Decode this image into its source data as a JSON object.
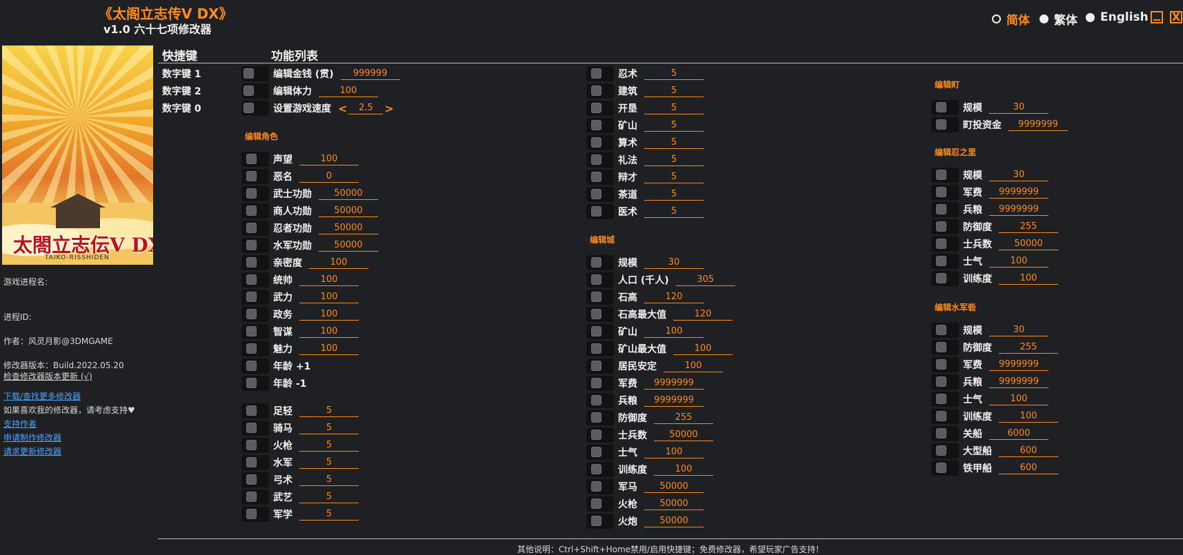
{
  "app": {
    "title": "《太阁立志传V DX》",
    "subtitle": "v1.0 六十七项修改器"
  },
  "languages": [
    {
      "label": "简体",
      "selected": true
    },
    {
      "label": "繁体",
      "selected": false
    },
    {
      "label": "English",
      "selected": false
    }
  ],
  "window_controls": {
    "minimize": "_",
    "close": "X"
  },
  "cover": {
    "logo_text": "太閤立志伝V DX",
    "logo_sub": "TAIKO-RISSHIDEN"
  },
  "sidebar": {
    "process_name_label": "游戏进程名:",
    "process_id_label": "进程ID:",
    "author": "作者：风灵月影@3DMGAME",
    "version": "修改器版本：Build.2022.05.20",
    "check_update": "检查修改器版本更新 (√)",
    "download_link": "下载/查找更多修改器",
    "support_text": "如果喜欢我的修改器，请考虑支持♥",
    "support_link": "支持作者",
    "request_link": "申请制作修改器",
    "update_link": "请求更新修改器"
  },
  "headers": {
    "hotkey": "快捷键",
    "features": "功能列表"
  },
  "hotkeys": [
    "数字键 1",
    "数字键 2",
    "数字键 0"
  ],
  "top_options": [
    {
      "label": "编辑金钱 (贯)",
      "value": "999999"
    },
    {
      "label": "编辑体力",
      "value": "100"
    }
  ],
  "speed": {
    "label": "设置游戏速度",
    "left": "<",
    "value": "2.5",
    "right": ">"
  },
  "col1": {
    "section_title": "编辑角色",
    "group1": [
      {
        "label": "声望",
        "value": "100"
      },
      {
        "label": "恶名",
        "value": "0"
      },
      {
        "label": "武士功勋",
        "value": "50000"
      },
      {
        "label": "商人功勋",
        "value": "50000"
      },
      {
        "label": "忍者功勋",
        "value": "50000"
      },
      {
        "label": "水军功勋",
        "value": "50000"
      },
      {
        "label": "亲密度",
        "value": "100"
      },
      {
        "label": "统帅",
        "value": "100"
      },
      {
        "label": "武力",
        "value": "100"
      },
      {
        "label": "政务",
        "value": "100"
      },
      {
        "label": "智谋",
        "value": "100"
      },
      {
        "label": "魅力",
        "value": "100"
      }
    ],
    "age_plus": "年龄 +1",
    "age_minus": "年龄 -1",
    "group2": [
      {
        "label": "足轻",
        "value": "5"
      },
      {
        "label": "骑马",
        "value": "5"
      },
      {
        "label": "火枪",
        "value": "5"
      },
      {
        "label": "水军",
        "value": "5"
      },
      {
        "label": "弓术",
        "value": "5"
      },
      {
        "label": "武艺",
        "value": "5"
      },
      {
        "label": "军学",
        "value": "5"
      }
    ]
  },
  "col2": {
    "skills": [
      {
        "label": "忍术",
        "value": "5"
      },
      {
        "label": "建筑",
        "value": "5"
      },
      {
        "label": "开垦",
        "value": "5"
      },
      {
        "label": "矿山",
        "value": "5"
      },
      {
        "label": "算术",
        "value": "5"
      },
      {
        "label": "礼法",
        "value": "5"
      },
      {
        "label": "辩才",
        "value": "5"
      },
      {
        "label": "茶道",
        "value": "5"
      },
      {
        "label": "医术",
        "value": "5"
      }
    ],
    "section_title": "编辑城",
    "castle": [
      {
        "label": "规模",
        "value": "30"
      },
      {
        "label": "人口 (千人)",
        "value": "305"
      },
      {
        "label": "石高",
        "value": "120"
      },
      {
        "label": "石高最大值",
        "value": "120"
      },
      {
        "label": "矿山",
        "value": "100"
      },
      {
        "label": "矿山最大值",
        "value": "100"
      },
      {
        "label": "居民安定",
        "value": "100"
      },
      {
        "label": "军费",
        "value": "9999999"
      },
      {
        "label": "兵粮",
        "value": "9999999"
      },
      {
        "label": "防御度",
        "value": "255"
      },
      {
        "label": "士兵数",
        "value": "50000"
      },
      {
        "label": "士气",
        "value": "100"
      },
      {
        "label": "训练度",
        "value": "100"
      },
      {
        "label": "军马",
        "value": "50000"
      },
      {
        "label": "火枪",
        "value": "50000"
      },
      {
        "label": "火炮",
        "value": "50000"
      }
    ]
  },
  "col3": {
    "town_title": "编辑町",
    "town": [
      {
        "label": "规模",
        "value": "30"
      },
      {
        "label": "町投资金",
        "value": "9999999"
      }
    ],
    "ninja_title": "编辑忍之里",
    "ninja": [
      {
        "label": "规模",
        "value": "30"
      },
      {
        "label": "军费",
        "value": "9999999"
      },
      {
        "label": "兵粮",
        "value": "9999999"
      },
      {
        "label": "防御度",
        "value": "255"
      },
      {
        "label": "士兵数",
        "value": "50000"
      },
      {
        "label": "士气",
        "value": "100"
      },
      {
        "label": "训练度",
        "value": "100"
      }
    ],
    "navy_title": "编辑水军砦",
    "navy": [
      {
        "label": "规模",
        "value": "30"
      },
      {
        "label": "防御度",
        "value": "255"
      },
      {
        "label": "军费",
        "value": "9999999"
      },
      {
        "label": "兵粮",
        "value": "9999999"
      },
      {
        "label": "士气",
        "value": "100"
      },
      {
        "label": "训练度",
        "value": "100"
      },
      {
        "label": "关船",
        "value": "6000"
      },
      {
        "label": "大型船",
        "value": "600"
      },
      {
        "label": "铁甲船",
        "value": "600"
      }
    ]
  },
  "footer": "其他说明：Ctrl+Shift+Home禁用/启用快捷键；免费修改器，希望玩家广告支持！",
  "colors": {
    "accent": "#ff8a1f",
    "background": "#1f2023",
    "link": "#4aa3ff"
  }
}
